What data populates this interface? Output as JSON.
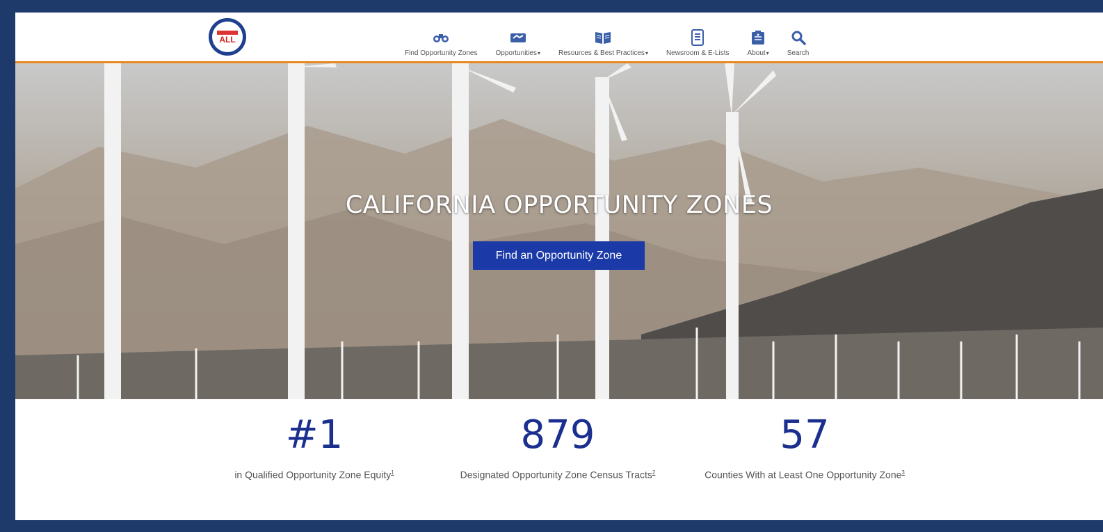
{
  "header": {
    "logo_text": "ALL",
    "nav": [
      {
        "label": "Find Opportunity Zones",
        "icon": "binoculars-icon",
        "dropdown": false
      },
      {
        "label": "Opportunities",
        "icon": "handshake-icon",
        "dropdown": true
      },
      {
        "label": "Resources & Best Practices",
        "icon": "book-icon",
        "dropdown": true
      },
      {
        "label": "Newsroom & E-Lists",
        "icon": "document-icon",
        "dropdown": false
      },
      {
        "label": "About",
        "icon": "clipboard-icon",
        "dropdown": true
      },
      {
        "label": "Search",
        "icon": "search-icon",
        "dropdown": false
      }
    ]
  },
  "hero": {
    "title": "CALIFORNIA OPPORTUNITY ZONES",
    "button_label": "Find an Opportunity Zone"
  },
  "stats": [
    {
      "value": "#1",
      "label": "in Qualified Opportunity Zone Equity",
      "footnote": "1"
    },
    {
      "value": "879",
      "label": "Designated Opportunity Zone Census Tracts",
      "footnote": "2"
    },
    {
      "value": "57",
      "label": "Counties With at Least One Opportunity Zone",
      "footnote": "3"
    }
  ],
  "colors": {
    "accent_orange": "#e8891f",
    "brand_blue": "#1b3aa8",
    "stat_blue": "#1b2f8f",
    "nav_icon_blue": "#3a5fa8"
  }
}
